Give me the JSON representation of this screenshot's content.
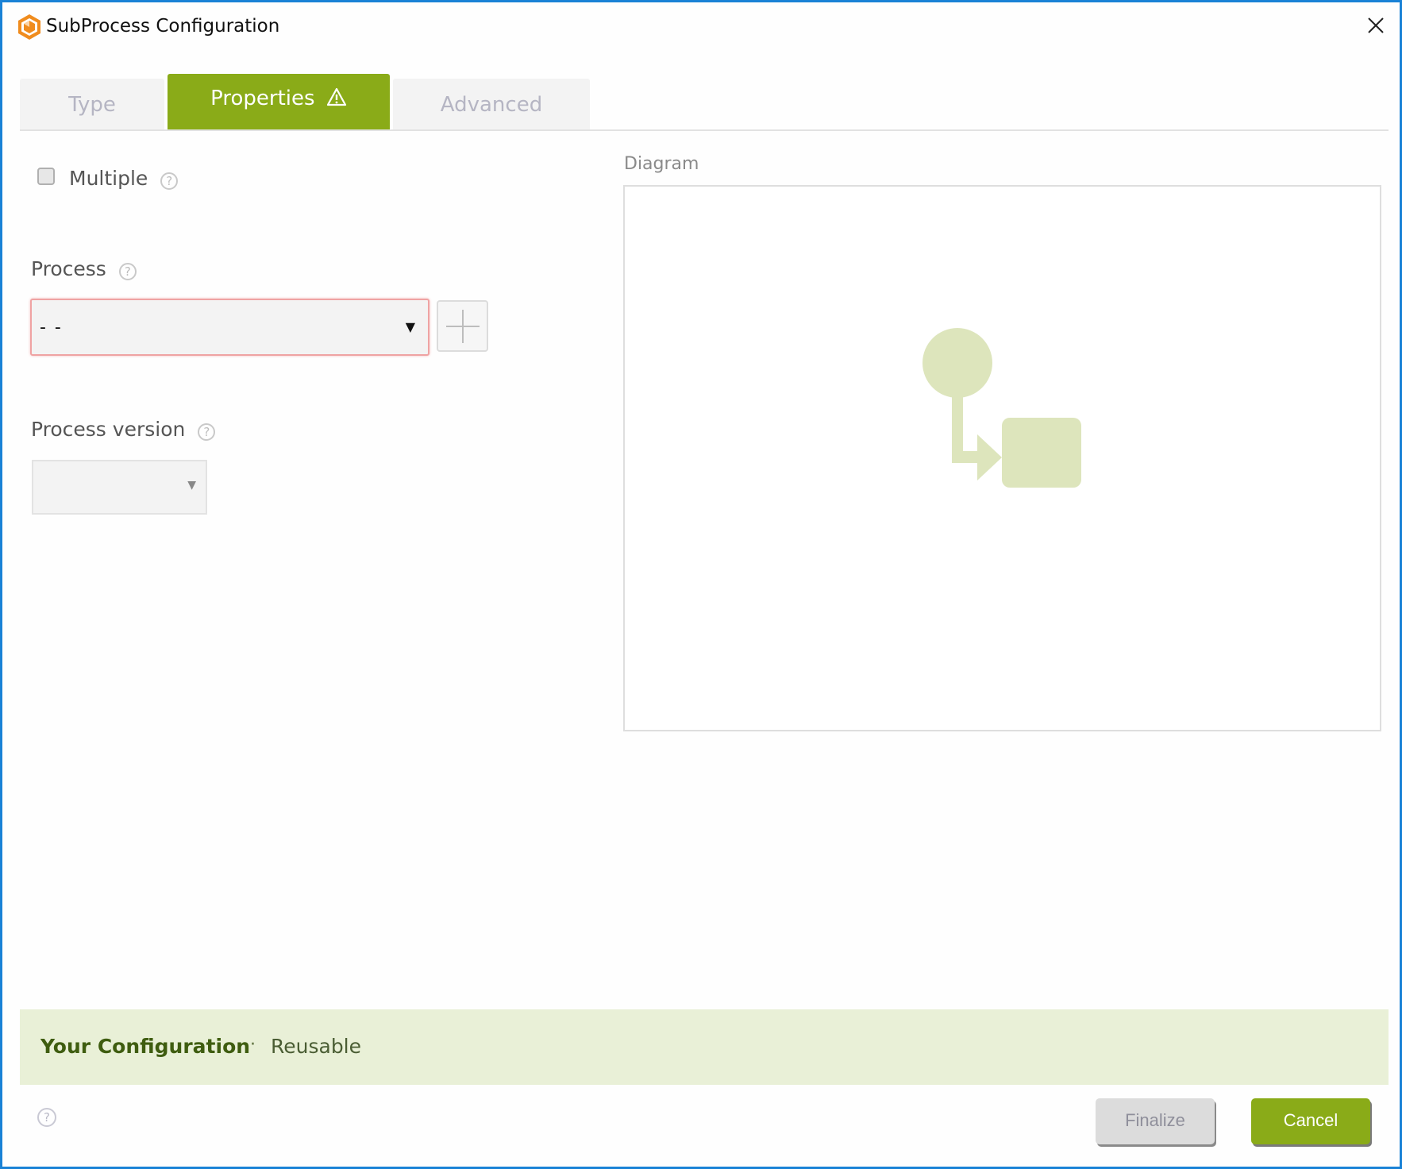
{
  "window": {
    "title": "SubProcess Configuration",
    "app_icon": "cube-hexagon-icon",
    "close_icon": "close-icon"
  },
  "tabs": [
    {
      "label": "Type",
      "active": false
    },
    {
      "label": "Properties",
      "active": true,
      "badge_icon": "warning-triangle-icon"
    },
    {
      "label": "Advanced",
      "active": false
    }
  ],
  "form": {
    "multiple": {
      "label": "Multiple",
      "checked": false,
      "help": "?"
    },
    "process": {
      "label": "Process",
      "help": "?",
      "value": "- -",
      "caret": "▼",
      "add_icon": "plus-icon",
      "invalid": true
    },
    "process_version": {
      "label": "Process version",
      "help": "?",
      "value": "",
      "caret": "▼"
    }
  },
  "diagram": {
    "label": "Diagram",
    "shapes": [
      "start-event-circle",
      "flow-arrow",
      "task-rectangle"
    ],
    "color": "#dde5bc"
  },
  "summary": {
    "title": "Your Configuration",
    "separator": "·",
    "value": "Reusable"
  },
  "footer": {
    "help": "?",
    "finalize_label": "Finalize",
    "cancel_label": "Cancel"
  },
  "colors": {
    "accent": "#8aab18",
    "window_border": "#1a82d6",
    "summary_bg": "#e9f0d7",
    "error_border": "#efa3a3"
  }
}
